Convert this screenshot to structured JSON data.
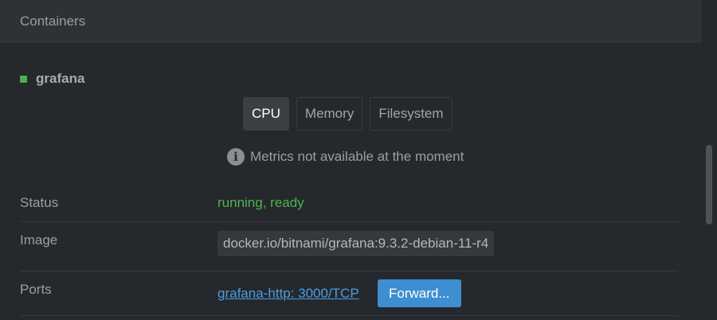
{
  "section": {
    "title": "Containers"
  },
  "container": {
    "name": "grafana",
    "status_color": "#48b04a"
  },
  "tabs": [
    {
      "label": "CPU",
      "active": true
    },
    {
      "label": "Memory",
      "active": false
    },
    {
      "label": "Filesystem",
      "active": false
    }
  ],
  "metrics": {
    "icon": "info-icon",
    "message": "Metrics not available at the moment"
  },
  "details": {
    "status": {
      "label": "Status",
      "value": "running, ready"
    },
    "image": {
      "label": "Image",
      "value": "docker.io/bitnami/grafana:9.3.2-debian-11-r4"
    },
    "ports": {
      "label": "Ports",
      "link": "grafana-http: 3000/TCP",
      "button": "Forward..."
    }
  },
  "colors": {
    "background": "#25282c",
    "header_bg": "#2e3136",
    "success": "#4eb550",
    "link": "#4a9ee0",
    "primary_button": "#3d8fd1"
  }
}
